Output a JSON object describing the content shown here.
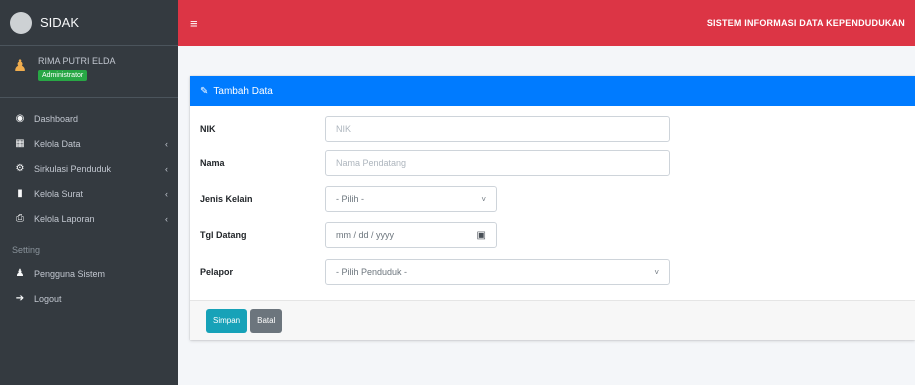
{
  "app": {
    "brand": "SIDAK"
  },
  "user": {
    "name": "RIMA PUTRI ELDA",
    "role": "Administrator"
  },
  "sidebar": {
    "items": [
      {
        "label": "Dashboard",
        "icon": "dashboard-icon",
        "has_children": false
      },
      {
        "label": "Kelola Data",
        "icon": "table-icon",
        "has_children": true
      },
      {
        "label": "Sirkulasi Penduduk",
        "icon": "cogs-icon",
        "has_children": true
      },
      {
        "label": "Kelola Surat",
        "icon": "file-icon",
        "has_children": true
      },
      {
        "label": "Kelola Laporan",
        "icon": "print-icon",
        "has_children": true
      }
    ],
    "section_header": "Setting",
    "settings_items": [
      {
        "label": "Pengguna Sistem",
        "icon": "user-icon"
      },
      {
        "label": "Logout",
        "icon": "logout-icon"
      }
    ]
  },
  "topbar": {
    "title": "SISTEM INFORMASI DATA KEPENDUDUKAN"
  },
  "form": {
    "header": "Tambah Data",
    "fields": {
      "nik": {
        "label": "NIK",
        "placeholder": "NIK"
      },
      "nama": {
        "label": "Nama",
        "placeholder": "Nama Pendatang"
      },
      "jenis_kelamin": {
        "label": "Jenis Kelain",
        "value": "- Pilih -"
      },
      "tgl_datang": {
        "label": "Tgl Datang",
        "value": "mm / dd / yyyy"
      },
      "pelapor": {
        "label": "Pelapor",
        "value": "- Pilih Penduduk -"
      }
    },
    "buttons": {
      "save": "Simpan",
      "cancel": "Batal"
    }
  },
  "colors": {
    "topbar": "#dc3545",
    "sidebar": "#343a40",
    "card_header": "#007bff",
    "save": "#17a2b8",
    "cancel": "#6c757d"
  }
}
